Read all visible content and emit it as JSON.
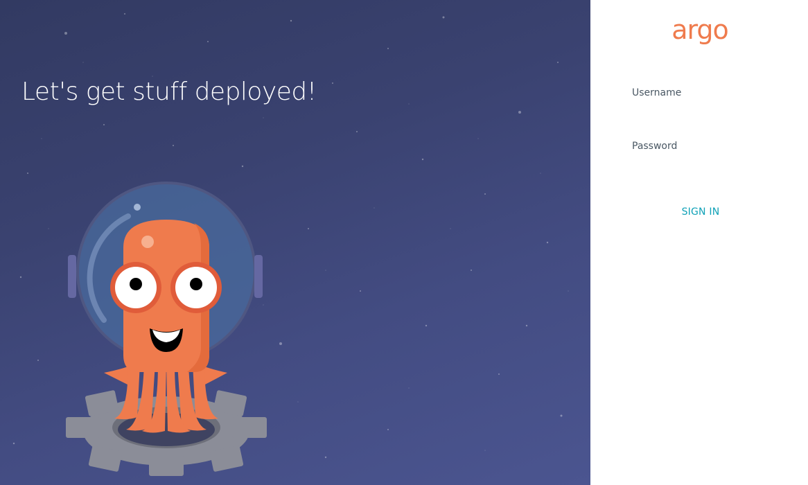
{
  "hero": {
    "tagline": "Let's get stuff deployed!",
    "mascot_icon": "octopus-astronaut-mascot-icon",
    "background_color": "#3d4575"
  },
  "login": {
    "logo_text": "argo",
    "logo_color": "#ef7b4d",
    "username_label": "Username",
    "username_value": "",
    "password_label": "Password",
    "password_value": "",
    "signin_label": "SIGN IN",
    "signin_color": "#0fa1b7"
  }
}
